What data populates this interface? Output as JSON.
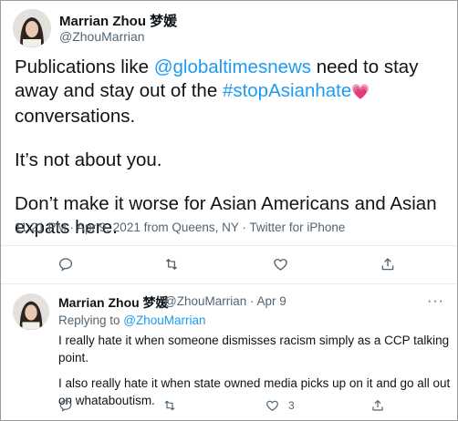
{
  "main_tweet": {
    "author_name": "Marrian Zhou 梦媛",
    "author_handle": "@ZhouMarrian",
    "text_p1_a": "Publications like ",
    "text_p1_mention": "@globaltimesnews",
    "text_p1_b": " need to stay away and stay out of the ",
    "text_p1_hashtag": "#stopAsianhate",
    "text_p1_emoji": "💗",
    "text_p1_c": " conversations.",
    "text_p2": "It’s not about you.",
    "text_p3": "Don’t make it worse for Asian Americans and Asian expats here.",
    "timestamp": "11:21 PM · Apr 9, 2021 from Queens, NY · Twitter for iPhone",
    "actions": [
      "reply-icon",
      "retweet-icon",
      "like-icon",
      "share-icon"
    ]
  },
  "reply_tweet": {
    "author_name": "Marrian Zhou 梦媛",
    "author_handle_date": "@ZhouMarrian · Apr 9",
    "more": "···",
    "replying_prefix": "Replying to ",
    "replying_to": "@ZhouMarrian",
    "text_p1": "I really hate it when someone dismisses racism simply as a CCP talking point.",
    "text_p2": "I also really hate it when state owned media picks up on it and go all out on whataboutism.",
    "like_count": "3",
    "actions": [
      "reply-icon",
      "retweet-icon",
      "like-icon",
      "share-icon"
    ]
  },
  "colors": {
    "link": "#1d9bf0",
    "secondary_text": "#536471",
    "divider": "#e6ecf0"
  }
}
